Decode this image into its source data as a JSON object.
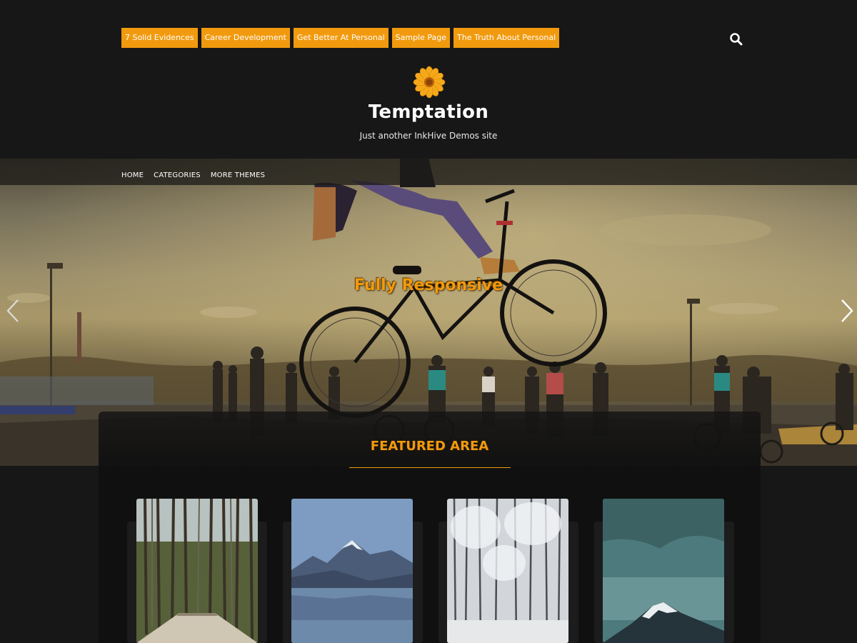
{
  "top_menu": {
    "items": [
      {
        "label": "7 Solid Evidences"
      },
      {
        "label": "Career Development"
      },
      {
        "label": "Get Better At Personal"
      },
      {
        "label": "Sample Page"
      },
      {
        "label": "The Truth About Personal"
      }
    ],
    "search_icon": "search-icon"
  },
  "site": {
    "logo_icon": "sunflower-logo",
    "title": "Temptation",
    "description": "Just another InkHive Demos site"
  },
  "main_nav": {
    "items": [
      {
        "label": "HOME"
      },
      {
        "label": "CATEGORIES"
      },
      {
        "label": "MORE THEMES"
      }
    ]
  },
  "slider": {
    "caption": "Fully Responsive",
    "prev_icon": "chevron-left-icon",
    "next_icon": "chevron-right-icon"
  },
  "featured": {
    "title": "FEATURED AREA",
    "cards": [
      {
        "image": "forest-boardwalk"
      },
      {
        "image": "mountain-lake"
      },
      {
        "image": "snowy-forest"
      },
      {
        "image": "snowy-peak"
      }
    ]
  },
  "colors": {
    "accent": "#f29a0e",
    "background": "#171717",
    "featured_bg": "#101010"
  }
}
